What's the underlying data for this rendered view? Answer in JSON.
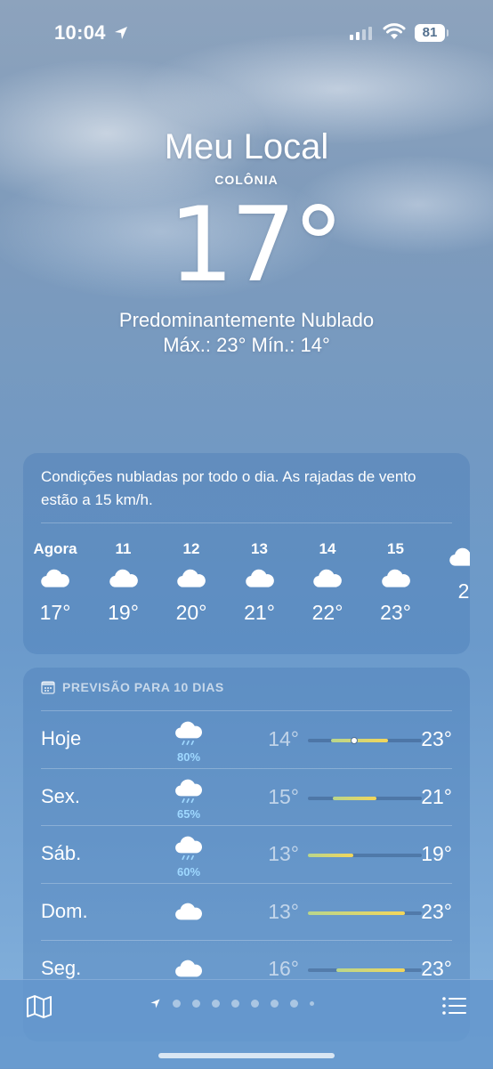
{
  "status_bar": {
    "time": "10:04",
    "battery": "81",
    "icons": [
      "location-arrow-icon",
      "cellular-signal-icon",
      "wifi-icon",
      "battery-icon"
    ]
  },
  "header": {
    "title": "Meu Local",
    "subtitle": "COLÔNIA",
    "temperature": "17°",
    "condition": "Predominantemente Nublado",
    "hi_lo": "Máx.: 23°  Mín.: 14°"
  },
  "hourly": {
    "summary": "Condições nubladas por todo o dia. As rajadas de vento estão a 15 km/h.",
    "hours": [
      {
        "label": "Agora",
        "icon": "cloud-icon",
        "temp": "17°"
      },
      {
        "label": "11",
        "icon": "cloud-icon",
        "temp": "19°"
      },
      {
        "label": "12",
        "icon": "cloud-icon",
        "temp": "20°"
      },
      {
        "label": "13",
        "icon": "cloud-icon",
        "temp": "21°"
      },
      {
        "label": "14",
        "icon": "cloud-icon",
        "temp": "22°"
      },
      {
        "label": "15",
        "icon": "cloud-icon",
        "temp": "23°"
      },
      {
        "label": "",
        "icon": "cloud-icon",
        "temp": "2"
      }
    ]
  },
  "daily": {
    "title": "PREVISÃO PARA 10 DIAS",
    "range": [
      13,
      23
    ],
    "days": [
      {
        "day": "Hoje",
        "icon": "cloud-rain-icon",
        "precip": "80%",
        "min": "14°",
        "max": "23°",
        "lo": 14,
        "hi": 23,
        "bar_lo": 15,
        "bar_hi": 20,
        "now": 17
      },
      {
        "day": "Sex.",
        "icon": "cloud-rain-icon",
        "precip": "65%",
        "min": "15°",
        "max": "21°",
        "lo": 15,
        "hi": 21,
        "bar_lo": 15.2,
        "bar_hi": 19
      },
      {
        "day": "Sáb.",
        "icon": "cloud-rain-icon",
        "precip": "60%",
        "min": "13°",
        "max": "19°",
        "lo": 13,
        "hi": 19,
        "bar_lo": 13,
        "bar_hi": 17
      },
      {
        "day": "Dom.",
        "icon": "cloud-icon",
        "precip": "",
        "min": "13°",
        "max": "23°",
        "lo": 13,
        "hi": 23,
        "bar_lo": 13,
        "bar_hi": 21.5
      },
      {
        "day": "Seg.",
        "icon": "cloud-icon",
        "precip": "",
        "min": "16°",
        "max": "23°",
        "lo": 16,
        "hi": 23,
        "bar_lo": 15.5,
        "bar_hi": 21.5
      }
    ]
  },
  "bottom_bar": {
    "icons": [
      "map-icon",
      "location-arrow-icon",
      "list-icon"
    ],
    "pages": 9,
    "current_page": 0
  },
  "colors": {
    "accent_precip": "#9fd8ff",
    "bar_start": "#b9d68c",
    "bar_end": "#f3d65a"
  }
}
